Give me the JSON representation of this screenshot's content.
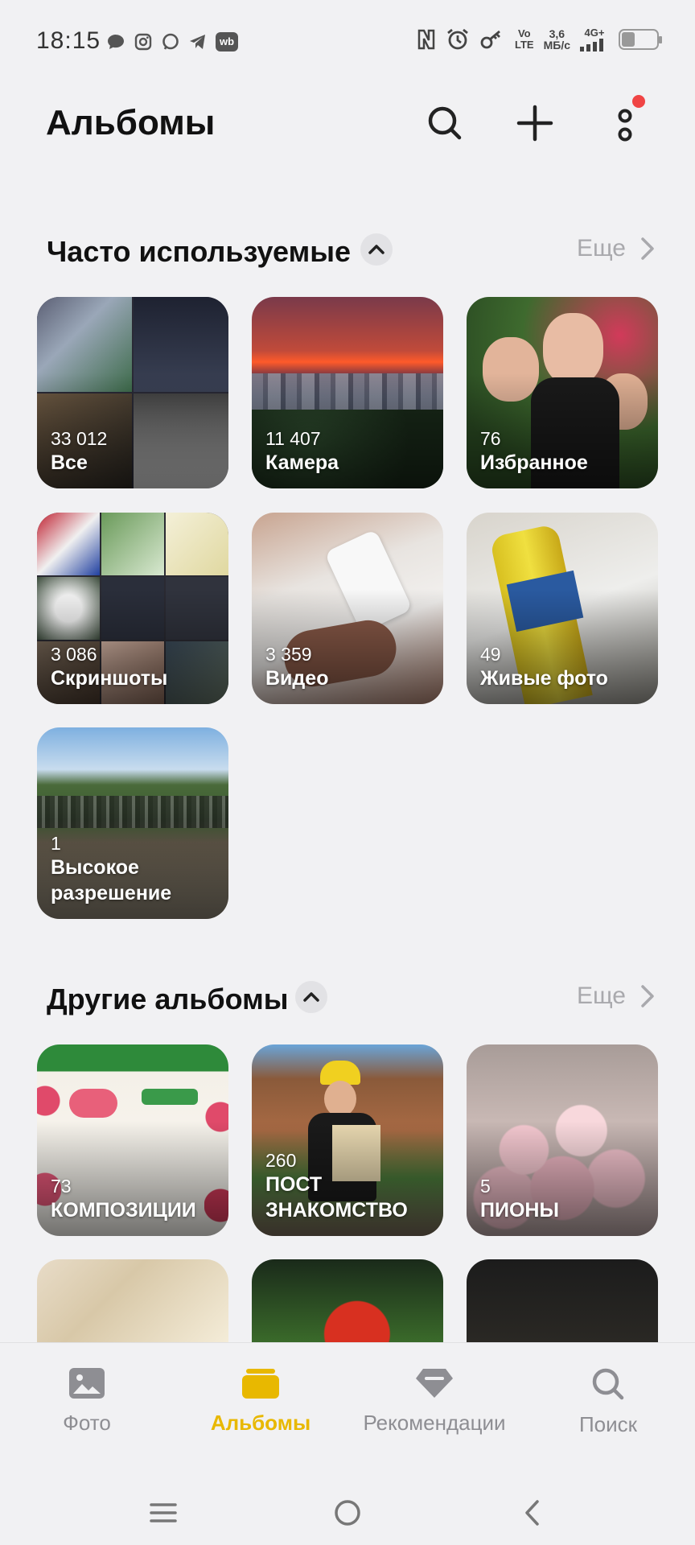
{
  "status_bar": {
    "time": "18:15",
    "net_speed_value": "3,6",
    "net_speed_unit": "МБ/с",
    "network_type": "4G+",
    "volte_line1": "Vo",
    "volte_line2": "LTE",
    "icons_left": [
      "chat-icon",
      "instagram-icon",
      "messenger-icon",
      "telegram-icon",
      "wb-icon"
    ],
    "icons_right": [
      "nfc-icon",
      "alarm-icon",
      "vpn-key-icon",
      "signal-icon",
      "battery-icon"
    ],
    "wb_label": "wb"
  },
  "header": {
    "title": "Альбомы",
    "icons": [
      "search-icon",
      "add-icon",
      "more-icon"
    ]
  },
  "frequent_section": {
    "title": "Часто используемые",
    "more_label": "Еще",
    "albums": [
      {
        "count": "33 012",
        "name": "Все"
      },
      {
        "count": "11 407",
        "name": "Камера"
      },
      {
        "count": "76",
        "name": "Избранное"
      },
      {
        "count": "3 086",
        "name": "Скриншоты"
      },
      {
        "count": "3 359",
        "name": "Видео"
      },
      {
        "count": "49",
        "name": "Живые фото"
      },
      {
        "count": "1",
        "name": "Высокое разрешение"
      }
    ]
  },
  "other_section": {
    "title": "Другие альбомы",
    "more_label": "Еще",
    "albums": [
      {
        "count": "73",
        "name": "КОМПОЗИЦИИ"
      },
      {
        "count": "260",
        "name": "ПОСТ ЗНАКОМСТВО"
      },
      {
        "count": "5",
        "name": "ПИОНЫ"
      }
    ]
  },
  "bottom_nav": {
    "items": [
      {
        "label": "Фото",
        "icon": "photo-icon"
      },
      {
        "label": "Альбомы",
        "icon": "albums-icon"
      },
      {
        "label": "Рекомендации",
        "icon": "recommendations-icon"
      },
      {
        "label": "Поиск",
        "icon": "search-icon"
      }
    ],
    "active_index": 1
  },
  "colors": {
    "accent": "#e8b800",
    "background": "#f1f1f3",
    "notification": "#f04444",
    "muted": "#a9a9ad"
  }
}
